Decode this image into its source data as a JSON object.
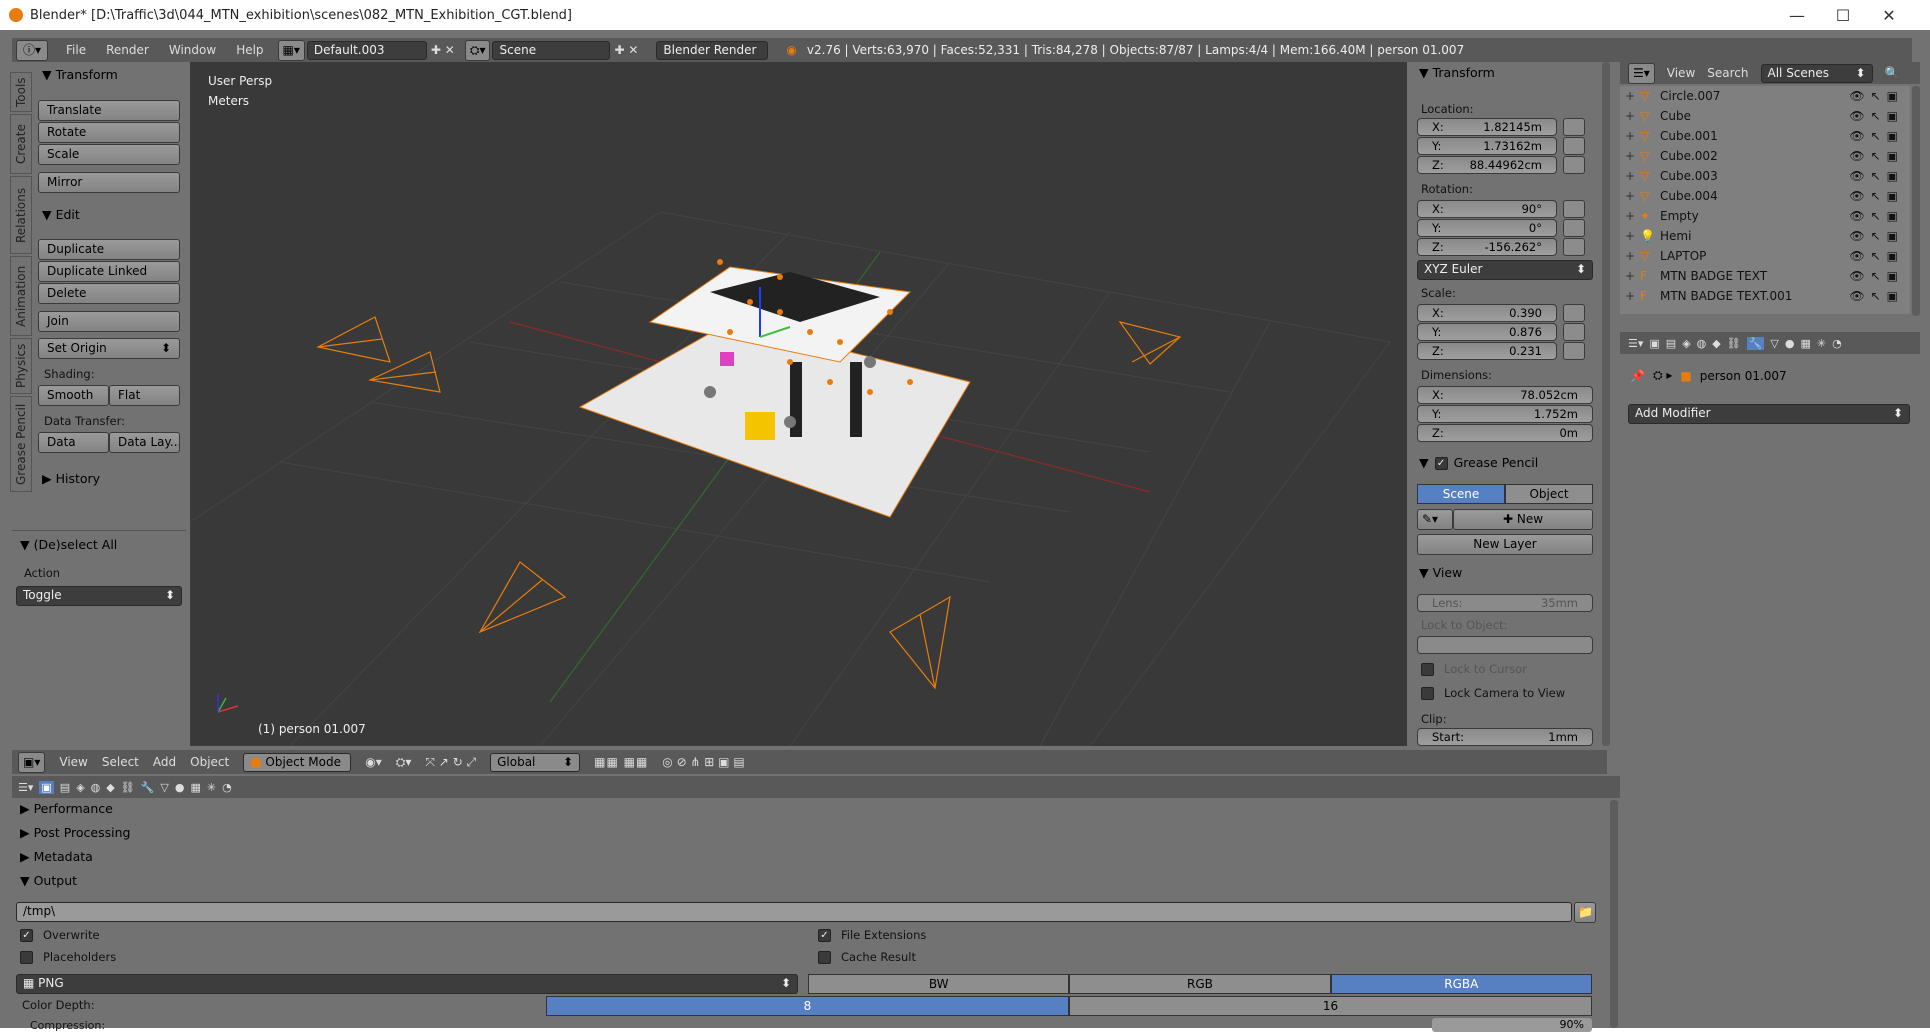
{
  "window": {
    "title": "Blender* [D:\\Traffic\\3d\\044_MTN_exhibition\\scenes\\082_MTN_Exhibition_CGT.blend]",
    "minimize": "—",
    "maximize": "☐",
    "close": "✕"
  },
  "menubar": {
    "items": [
      "File",
      "Render",
      "Window",
      "Help"
    ],
    "layout": "Default.003",
    "scene": "Scene",
    "engine": "Blender Render",
    "stats": "v2.76 | Verts:63,970 | Faces:52,331 | Tris:84,278 | Objects:87/87 | Lamps:4/4 | Mem:166.40M | person 01.007"
  },
  "tool_tabs": [
    "Tools",
    "Create",
    "Relations",
    "Animation",
    "Physics",
    "Grease Pencil"
  ],
  "toolshelf": {
    "transform_header": "Transform",
    "translate": "Translate",
    "rotate": "Rotate",
    "scale": "Scale",
    "mirror": "Mirror",
    "edit_header": "Edit",
    "duplicate": "Duplicate",
    "duplicate_linked": "Duplicate Linked",
    "delete": "Delete",
    "join": "Join",
    "set_origin": "Set Origin",
    "shading_label": "Shading:",
    "smooth": "Smooth",
    "flat": "Flat",
    "data_transfer_label": "Data Transfer:",
    "data": "Data",
    "data_layout": "Data Lay...",
    "history": "History",
    "deselect_header": "(De)select All",
    "action_label": "Action",
    "action_value": "Toggle"
  },
  "viewport": {
    "view_name": "User Persp",
    "units": "Meters",
    "object_label": "(1) person 01.007"
  },
  "properties_n": {
    "transform_header": "Transform",
    "location_label": "Location:",
    "loc_x": "1.82145m",
    "loc_y": "1.73162m",
    "loc_z": "88.44962cm",
    "rotation_label": "Rotation:",
    "rot_x": "90°",
    "rot_y": "0°",
    "rot_z": "-156.262°",
    "rotation_mode": "XYZ Euler",
    "scale_label": "Scale:",
    "scale_x": "0.390",
    "scale_y": "0.876",
    "scale_z": "0.231",
    "dimensions_label": "Dimensions:",
    "dim_x": "78.052cm",
    "dim_y": "1.752m",
    "dim_z": "0m",
    "grease_header": "Grease Pencil",
    "gp_scene": "Scene",
    "gp_object": "Object",
    "gp_new": "New",
    "gp_new_layer": "New Layer",
    "view_header": "View",
    "lens": "Lens:",
    "lens_value": "35mm",
    "lock_object": "Lock to Object:",
    "lock_cursor": "Lock to Cursor",
    "lock_camera": "Lock Camera to View",
    "clip": "Clip:",
    "clip_start": "Start:",
    "clip_start_value": "1mm",
    "x": "X:",
    "y": "Y:",
    "z": "Z:"
  },
  "outliner": {
    "view": "View",
    "search": "Search",
    "filter": "All Scenes",
    "items": [
      "Circle.007",
      "Cube",
      "Cube.001",
      "Cube.002",
      "Cube.003",
      "Cube.004",
      "Empty",
      "Hemi",
      "LAPTOP",
      "MTN BADGE TEXT",
      "MTN BADGE TEXT.001"
    ]
  },
  "modifier_panel": {
    "object": "person 01.007",
    "add_modifier": "Add Modifier"
  },
  "viewport_header": {
    "view": "View",
    "select": "Select",
    "add": "Add",
    "object": "Object",
    "mode": "Object Mode",
    "orientation": "Global"
  },
  "render_props": {
    "performance": "Performance",
    "post_processing": "Post Processing",
    "metadata": "Metadata",
    "output": "Output",
    "path": "/tmp\\",
    "overwrite": "Overwrite",
    "placeholders": "Placeholders",
    "file_extensions": "File Extensions",
    "cache_result": "Cache Result",
    "format": "PNG",
    "bw": "BW",
    "rgb": "RGB",
    "rgba": "RGBA",
    "color_depth": "Color Depth:",
    "depth_8": "8",
    "depth_16": "16",
    "compression": "Compression:",
    "compression_value": "90%"
  },
  "colors": {
    "accent": "#5680c2",
    "selection": "#e87d0d",
    "viewport_bg": "#393939",
    "panel": "#727272"
  }
}
